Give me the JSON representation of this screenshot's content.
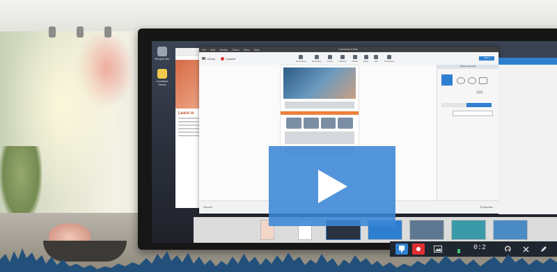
{
  "player": {
    "play_label": "",
    "overlay_color": "#3a86d6"
  },
  "desktop": {
    "icons": [
      {
        "label": "Recycle Bin",
        "icon": "recycle-bin-icon"
      },
      {
        "label": "Camtasia Studio",
        "icon": "app-shortcut-icon"
      }
    ]
  },
  "app": {
    "menu": [
      "File",
      "Edit",
      "Modify",
      "Share",
      "View",
      "Help"
    ],
    "window_title": "Camtasia Editor",
    "library_label": "Library",
    "capture_label": "Capture",
    "tools": [
      "Annotations",
      "Behaviors",
      "Cursor",
      "Callouts",
      "Visual",
      "Audio",
      "Narr",
      "Transitions"
    ],
    "share_label": "Share",
    "props_title": "Shape Properties",
    "status_left": "Record",
    "status_right": "Properties",
    "page_logo": "",
    "page_banner": "",
    "page_heading": ""
  },
  "browser": {
    "heading": "Learn w"
  },
  "recorder": {
    "time": "0:2"
  },
  "colors": {
    "accent": "#2f7fd0",
    "record": "#e03030",
    "orange": "#ef7e3a",
    "waveform": "#22507a"
  }
}
